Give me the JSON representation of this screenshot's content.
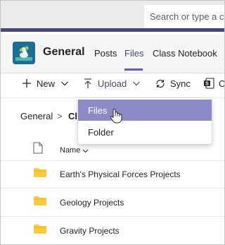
{
  "topbar": {
    "search_placeholder": "Search or type a co"
  },
  "channel": {
    "name": "General",
    "tabs": [
      {
        "label": "Posts",
        "active": false
      },
      {
        "label": "Files",
        "active": true
      },
      {
        "label": "Class Notebook",
        "active": false
      }
    ]
  },
  "toolbar": {
    "new_label": "New",
    "upload_label": "Upload",
    "sync_label": "Sync",
    "open_label": "O"
  },
  "breadcrumb": {
    "root": "General",
    "separator": ">",
    "current": "Cl"
  },
  "upload_menu": {
    "items": [
      {
        "label": "Files",
        "highlighted": true
      },
      {
        "label": "Folder",
        "highlighted": false
      }
    ]
  },
  "file_list": {
    "column_name": "Name",
    "rows": [
      {
        "name": "Earth's Physical Forces Projects",
        "type": "folder-icon"
      },
      {
        "name": "Geology Projects",
        "type": "folder-icon"
      },
      {
        "name": "Gravity Projects",
        "type": "folder-icon"
      }
    ]
  },
  "colors": {
    "accent": "#6264a7",
    "topbar_border": "#464775",
    "menu_highlight": "#8b8cc7",
    "folder": "#ffcb3d"
  }
}
